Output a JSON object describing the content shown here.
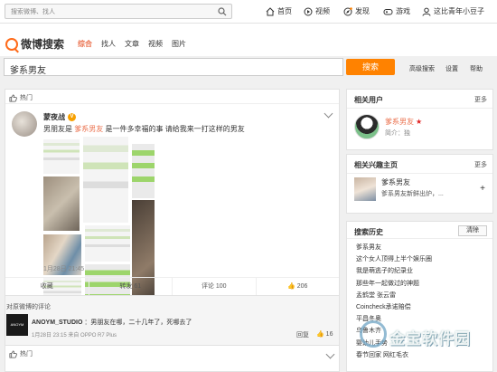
{
  "topnav": {
    "search_placeholder": "搜索微博、找人",
    "items": [
      {
        "label": "首页",
        "icon": "home-icon"
      },
      {
        "label": "视频",
        "icon": "video-icon"
      },
      {
        "label": "发现",
        "icon": "discover-icon"
      },
      {
        "label": "游戏",
        "icon": "game-icon"
      },
      {
        "label": "这比青年小豆子",
        "icon": "user-icon"
      }
    ]
  },
  "brand": {
    "logo_text": "微博搜索",
    "tabs": [
      "综合",
      "找人",
      "文章",
      "视频",
      "图片"
    ],
    "active_tab": "综合"
  },
  "search": {
    "query": "爹系男友",
    "button": "搜索",
    "links": [
      "高级搜索",
      "设置",
      "帮助"
    ]
  },
  "feed": {
    "section_label": "热门",
    "post": {
      "author": "蒙夜战",
      "verified_badge": "V",
      "text_before": "男朋友是",
      "keyword": "爹系男友",
      "text_after": "是一件多幸福的事 请给我来一打这样的男友",
      "time": "1月28日 21:45",
      "actions": {
        "fav": "收藏",
        "repost": "转发 61",
        "comment": "评论 100",
        "like": "206"
      }
    },
    "comments": {
      "header": "对原微博的评论",
      "items": [
        {
          "avatar_text": "ANOYM",
          "name": "ANOYM_STUDIO",
          "text": "：男朋友在哪，二十几年了，死哪去了",
          "meta": "1月28日 23:15 来自 OPPO R7 Plus",
          "reply": "回复",
          "likes": "16"
        }
      ]
    },
    "next_section_label": "热门"
  },
  "sidebar": {
    "related_users": {
      "title": "相关用户",
      "more": "更多",
      "user_name": "爹系男友",
      "user_sub": "简介：独"
    },
    "related_topics": {
      "title": "相关兴趣主页",
      "more": "更多",
      "topic_name": "爹系男友",
      "topic_desc": "爹系男友新鲜出炉，...",
      "plus": "+"
    },
    "history": {
      "title": "搜索历史",
      "clear": "清除",
      "items": [
        "爹系男友",
        "这个女人顶得上半个娱乐圈",
        "我是萌逃子的纪录业",
        "那些年一起做过的神题",
        "孟鹤堂 张云雷",
        "Coincheck承诺赔偿",
        "平昌冬奥",
        "乌鲁木齐",
        "婴幼儿手势",
        "春节回家 网红毛衣"
      ]
    }
  },
  "watermark": {
    "text": "金宝软件园"
  }
}
